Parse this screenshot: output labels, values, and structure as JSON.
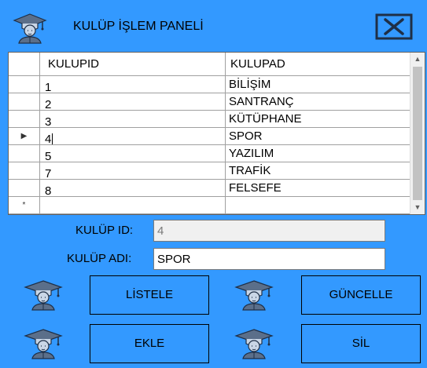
{
  "header": {
    "title": "KULÜP İŞLEM PANELİ"
  },
  "grid": {
    "columns": [
      "KULUPID",
      "KULUPAD"
    ],
    "rows": [
      {
        "id": "1",
        "name": "BİLİŞİM"
      },
      {
        "id": "2",
        "name": "SANTRANÇ"
      },
      {
        "id": "3",
        "name": "KÜTÜPHANE"
      },
      {
        "id": "4",
        "name": "SPOR"
      },
      {
        "id": "5",
        "name": "YAZILIM"
      },
      {
        "id": "7",
        "name": "TRAFİK"
      },
      {
        "id": "8",
        "name": "FELSEFE"
      }
    ],
    "current_row_marker": "▶",
    "new_row_marker": "*"
  },
  "form": {
    "id_label": "KULÜP ID:",
    "id_value": "4",
    "name_label": "KULÜP ADI:",
    "name_value": "SPOR"
  },
  "buttons": {
    "list": "LİSTELE",
    "update": "GÜNCELLE",
    "add": "EKLE",
    "delete": "SİL"
  },
  "icons": {
    "graduate": "graduate-icon",
    "close": "close-icon"
  },
  "colors": {
    "background": "#3399ff",
    "grid_background": "#ffffff"
  }
}
